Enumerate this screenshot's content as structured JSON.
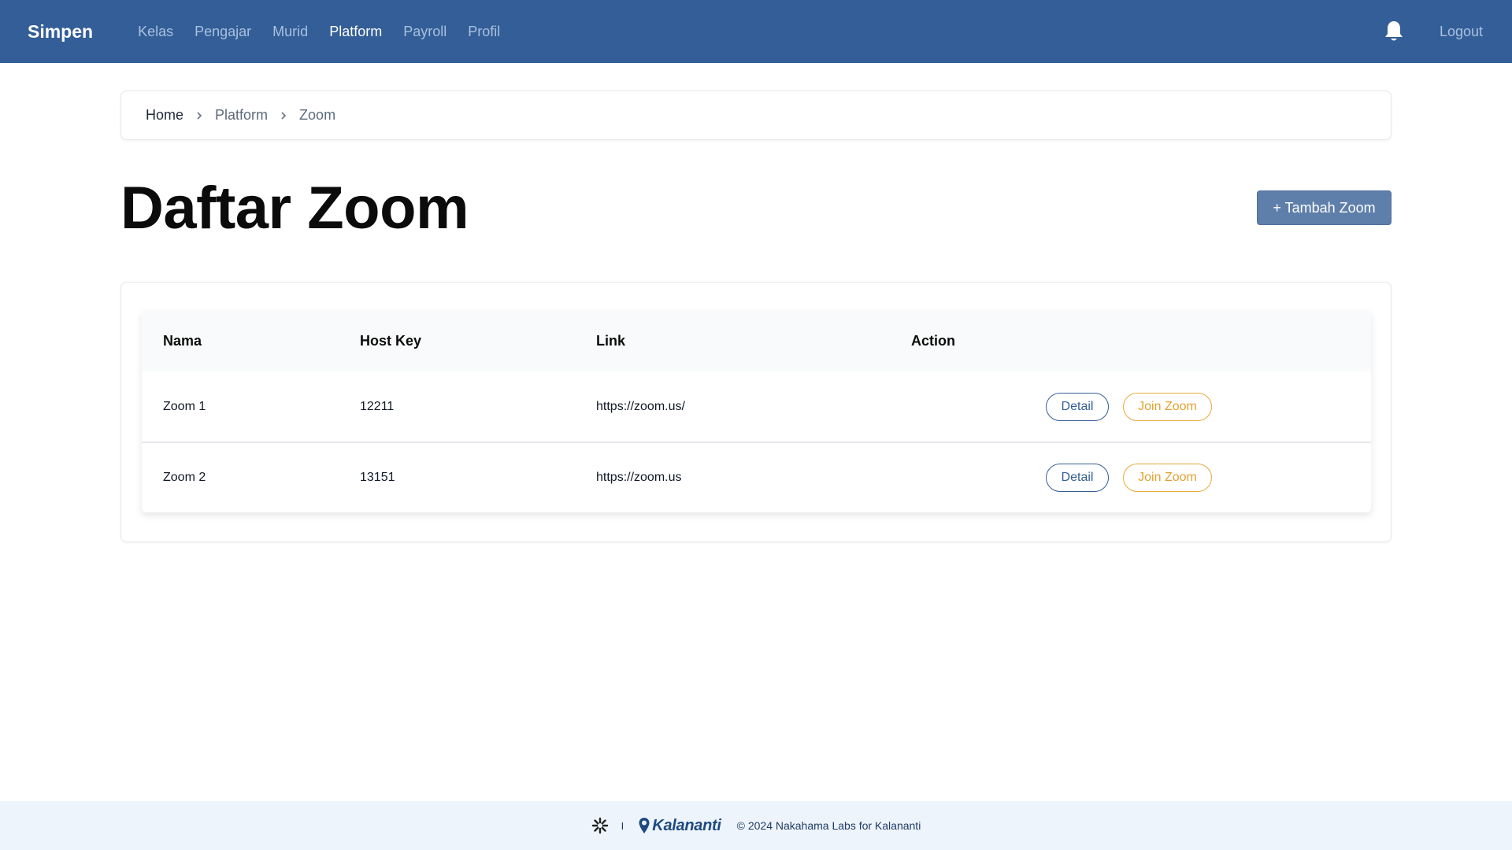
{
  "navbar": {
    "brand": "Simpen",
    "links": [
      {
        "label": "Kelas",
        "active": false
      },
      {
        "label": "Pengajar",
        "active": false
      },
      {
        "label": "Murid",
        "active": false
      },
      {
        "label": "Platform",
        "active": true
      },
      {
        "label": "Payroll",
        "active": false
      },
      {
        "label": "Profil",
        "active": false
      }
    ],
    "bell_icon": "bell-icon",
    "logout_label": "Logout"
  },
  "breadcrumb": {
    "items": [
      "Home",
      "Platform",
      "Zoom"
    ],
    "separator_icon": "chevron-right-icon"
  },
  "page": {
    "title": "Daftar Zoom",
    "add_button_label": "+ Tambah Zoom"
  },
  "table": {
    "headers": {
      "name": "Nama",
      "host_key": "Host Key",
      "link": "Link",
      "action": "Action"
    },
    "rows": [
      {
        "name": "Zoom 1",
        "host_key": "12211",
        "link": "https://zoom.us/",
        "detail_label": "Detail",
        "join_label": "Join Zoom"
      },
      {
        "name": "Zoom 2",
        "host_key": "13151",
        "link": "https://zoom.us",
        "detail_label": "Detail",
        "join_label": "Join Zoom"
      }
    ]
  },
  "footer": {
    "separator": "I",
    "brand_logo_text": "Kalananti",
    "copyright": "© 2024 Nakahama Labs for Kalananti"
  },
  "colors": {
    "navbar": "#335e97",
    "nav_inactive": "#a9c0df",
    "primary": "#335e97",
    "join_accent": "#e3a130",
    "add_button": "#5f7fab",
    "footer_bg": "#eef4fc"
  }
}
